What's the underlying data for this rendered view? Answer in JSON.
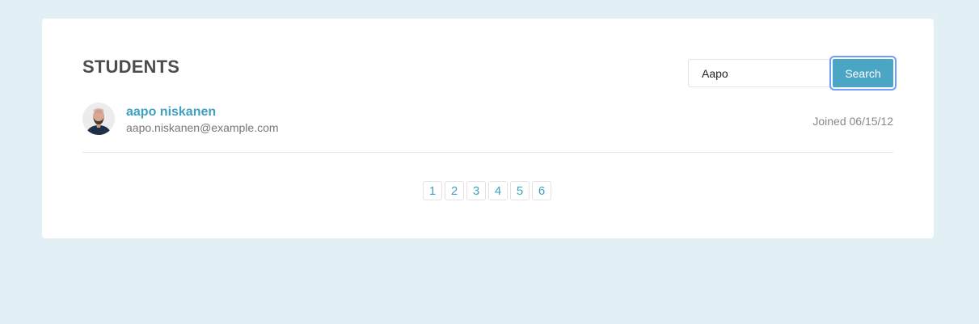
{
  "page": {
    "title": "STUDENTS"
  },
  "search": {
    "value": "Aapo",
    "placeholder": "",
    "button_label": "Search"
  },
  "students": [
    {
      "name": "aapo niskanen",
      "email": "aapo.niskanen@example.com",
      "joined": "Joined 06/15/12",
      "avatar_icon": "user-avatar-photo"
    }
  ],
  "pagination": {
    "pages": [
      "1",
      "2",
      "3",
      "4",
      "5",
      "6"
    ]
  },
  "colors": {
    "background": "#e2f0f6",
    "card": "#ffffff",
    "accent": "#3ea0c3",
    "button": "#4aa6c4",
    "focus_ring": "#6d9eff",
    "title": "#4d4d4d"
  }
}
